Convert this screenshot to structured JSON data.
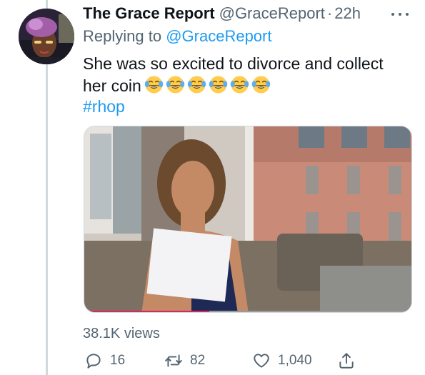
{
  "tweet": {
    "display_name": "The Grace Report",
    "handle": "@GraceReport",
    "separator": "·",
    "time": "22h",
    "replying_prefix": "Replying to",
    "replying_to": "@GraceReport",
    "text": "She was so excited to divorce and collect her coin",
    "emoji": "face-with-tears-of-joy",
    "emoji_count": 6,
    "hashtag": "#rhop",
    "views_count": "38.1K",
    "views_label": "views"
  },
  "actions": {
    "reply_count": "16",
    "retweet_count": "82",
    "like_count": "1,040"
  },
  "icons": {
    "reply": "speech-bubble-icon",
    "retweet": "retweet-arrows-icon",
    "like": "heart-icon",
    "share": "share-upload-icon",
    "more": "three-dots-icon"
  },
  "colors": {
    "link": "#1d9bf0",
    "secondary_text": "#536471",
    "primary_text": "#0f1419",
    "thread_line": "#cfd9de"
  }
}
